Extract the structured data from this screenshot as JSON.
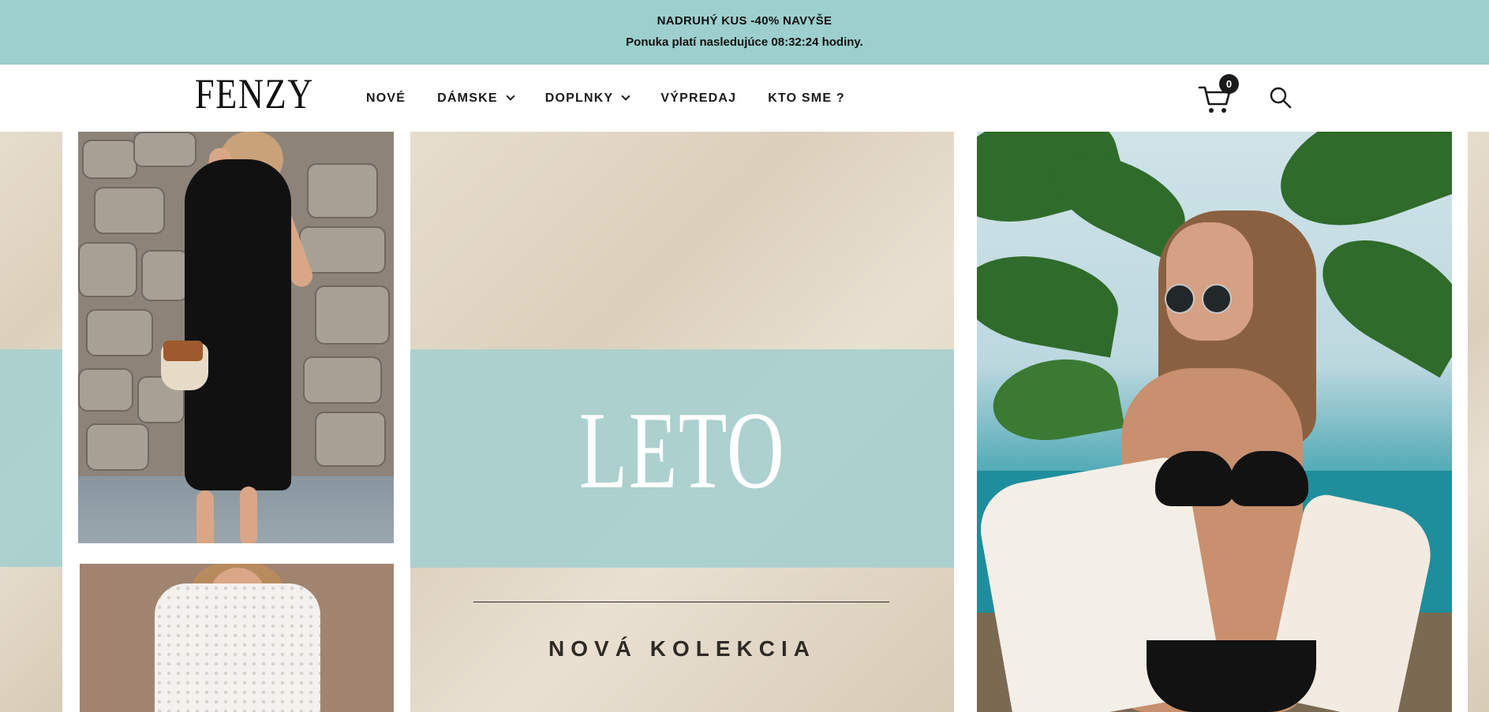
{
  "promo": {
    "line1": "NADRUHÝ KUS -40% NAVYŠE",
    "line2": "Ponuka platí nasledujúce 08:32:24 hodiny."
  },
  "header": {
    "logo": "FENZY",
    "nav": [
      {
        "label": "NOVÉ",
        "has_dropdown": false
      },
      {
        "label": "DÁMSKE",
        "has_dropdown": true
      },
      {
        "label": "DOPLNKY",
        "has_dropdown": true
      },
      {
        "label": "VÝPREDAJ",
        "has_dropdown": false
      },
      {
        "label": "KTO SME ?",
        "has_dropdown": false
      }
    ],
    "cart_count": "0",
    "icons": {
      "cart": "cart-icon",
      "search": "search-icon"
    }
  },
  "hero": {
    "title": "LETO",
    "subtitle": "NOVÁ KOLEKCIA"
  },
  "colors": {
    "promo_bg": "#9ccfcd",
    "teal_band": "#a9d0cd",
    "sand": "#e2d7c6",
    "text_dark": "#1a1a1a"
  }
}
